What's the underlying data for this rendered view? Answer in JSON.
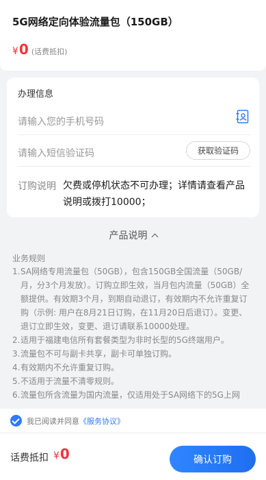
{
  "product": {
    "title": "5G网络定向体验流量包（150GB）",
    "currency": "¥",
    "price": "0",
    "price_note": "(话费抵扣)"
  },
  "form": {
    "section_title": "办理信息",
    "phone_placeholder": "请输入您的手机号码",
    "sms_placeholder": "请输入短信验证码",
    "get_code_label": "获取验证码",
    "note_label": "订购说明",
    "note_text": "欠费或停机状态不可办理；详情请查看产品说明或拨打10000；"
  },
  "description": {
    "header": "产品说明",
    "rules_title": "业务规则",
    "rules": [
      {
        "num": "1.",
        "text": "SA网络专用流量包（50GB），包含150GB全国流量（50GB/月，分3个月发放）。订购立即生效，当月包内流量（50GB）全额提供。有效期3个月，到期自动退订，有效期内不允许重复订购（示例: 用户在8月21日订购，在11月20日后退订）。变更、退订立即生效，变更、退订请联系10000处理。"
      },
      {
        "num": "2.",
        "text": "适用于福建电信所有套餐类型为非时长型的5G终端用户。"
      },
      {
        "num": "3.",
        "text": "流量包不可与副卡共享，副卡可单独订购。"
      },
      {
        "num": "4.",
        "text": "有效期内不允许重复订购。"
      },
      {
        "num": "5.",
        "text": "不适用于流量不清零规则。"
      },
      {
        "num": "6.",
        "text": "流量包所含流量为国内流量，仅适用处于SA网络下的5G上网"
      }
    ]
  },
  "agreement": {
    "prefix": "我已阅读并同意",
    "link": "《服务协议》"
  },
  "footer": {
    "total_label": "话费抵扣",
    "currency": "¥",
    "total_price": "0",
    "confirm_label": "确认订购"
  },
  "colors": {
    "accent_blue": "#2f7bf5",
    "price_red": "#f2333a"
  }
}
